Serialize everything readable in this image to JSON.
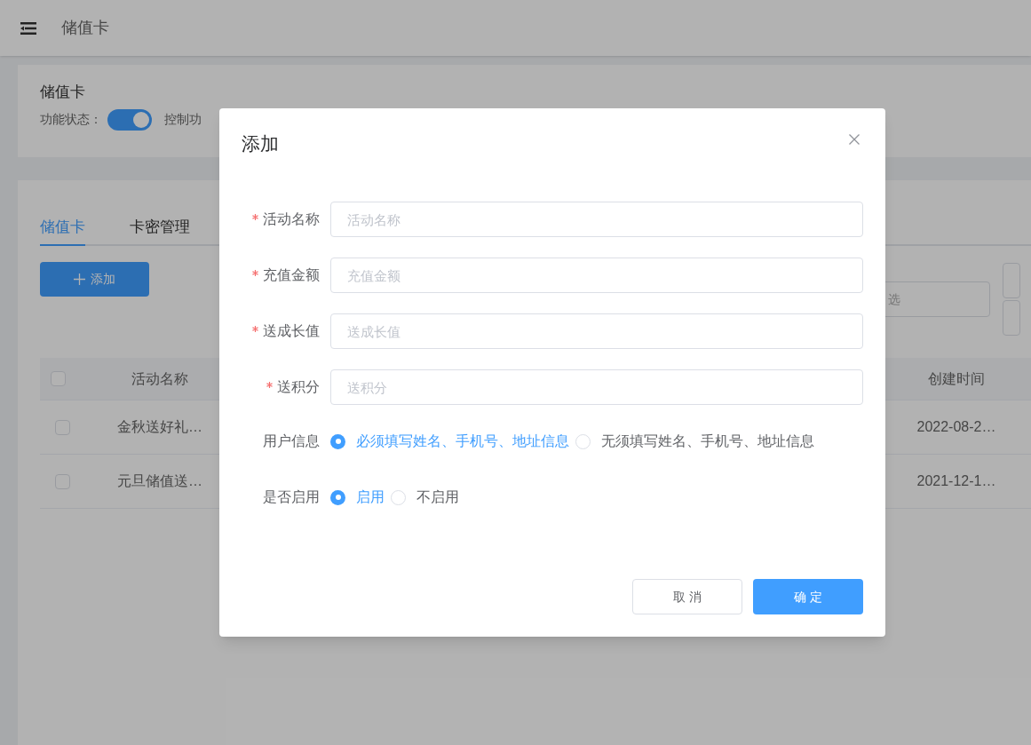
{
  "header": {
    "title": "储值卡"
  },
  "status_card": {
    "title": "储值卡",
    "label": "功能状态：",
    "toggle_on": true,
    "description": "控制功"
  },
  "tabs": [
    {
      "label": "储值卡",
      "selected": true
    },
    {
      "label": "卡密管理",
      "selected": false
    }
  ],
  "add_button": {
    "label": "添加"
  },
  "filter_field": {
    "placeholder": "选"
  },
  "table": {
    "select_all_checked": false,
    "columns": [
      "活动名称",
      "创建时间"
    ],
    "rows": [
      {
        "checked": false,
        "name": "金秋送好礼…",
        "created": "2022-08-2…"
      },
      {
        "checked": false,
        "name": "元旦储值送…",
        "created": "2021-12-1…"
      }
    ]
  },
  "dialog": {
    "title": "添加",
    "fields": [
      {
        "label": "活动名称",
        "required": true,
        "placeholder": "活动名称"
      },
      {
        "label": "充值金额",
        "required": true,
        "placeholder": "充值金额"
      },
      {
        "label": "送成长值",
        "required": true,
        "placeholder": "送成长值"
      },
      {
        "label": "送积分",
        "required": true,
        "placeholder": "送积分"
      }
    ],
    "radio_groups": [
      {
        "label": "用户信息",
        "options": [
          {
            "label": "必须填写姓名、手机号、地址信息",
            "selected": true
          },
          {
            "label": "无须填写姓名、手机号、地址信息",
            "selected": false
          }
        ]
      },
      {
        "label": "是否启用",
        "options": [
          {
            "label": "启用",
            "selected": true
          },
          {
            "label": "不启用",
            "selected": false
          }
        ]
      }
    ],
    "buttons": [
      {
        "label": "取 消",
        "kind": "secondary"
      },
      {
        "label": "确 定",
        "kind": "primary"
      }
    ]
  }
}
